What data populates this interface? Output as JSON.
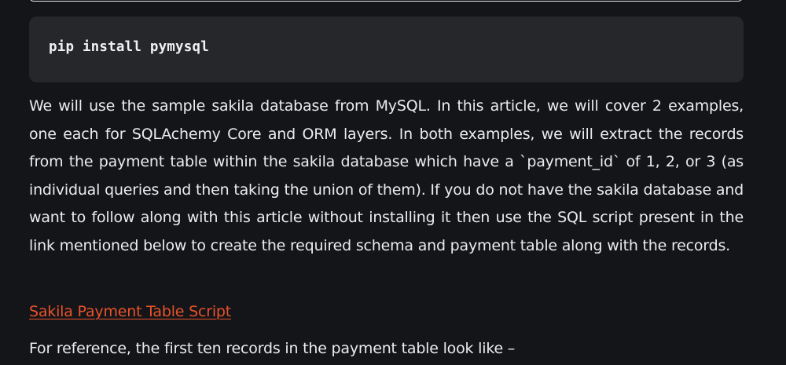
{
  "code_block": {
    "command": "pip install pymysql"
  },
  "article": {
    "intro_paragraph": "We will use the sample sakila database from MySQL. In this article, we will cover 2 examples, one each for SQLAchemy Core and ORM layers. In both examples, we will extract the records from the payment table within the sakila database which have a `payment_id` of 1, 2, or 3 (as individual queries and then taking the union of them). If you do not have the sakila database and want to follow along with this article without installing it then use the SQL script present in the link mentioned below to create the required schema and payment table along with the records.",
    "script_link_text": "Sakila Payment Table Script",
    "reference_text": "For reference, the first ten records in the payment table look like –"
  },
  "colors": {
    "background": "#141519",
    "code_background": "#26272b",
    "link": "#e8522a",
    "text": "#ececef"
  }
}
